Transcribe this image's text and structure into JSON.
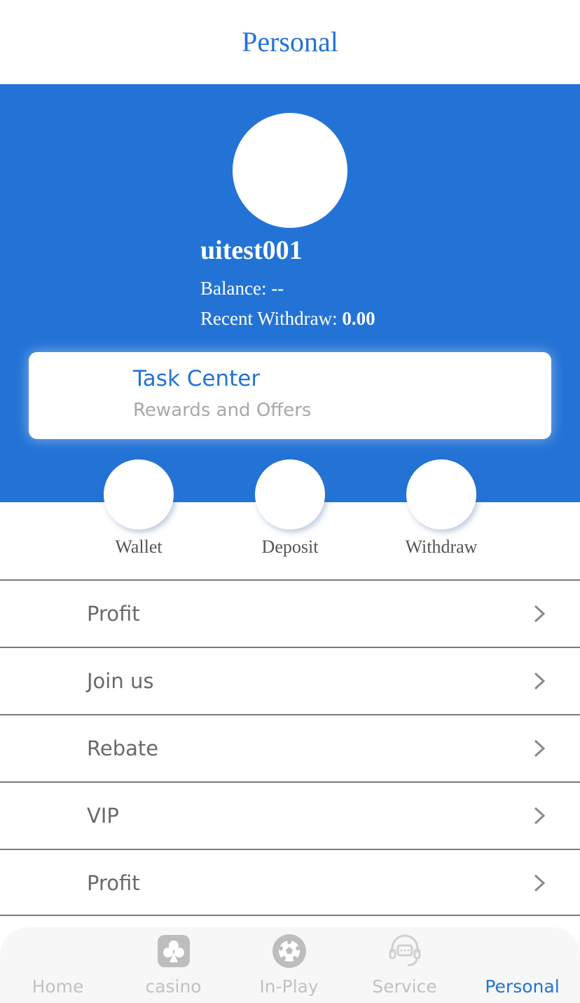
{
  "header": {
    "title": "Personal"
  },
  "profile": {
    "username": "uitest001",
    "balance_label": "Balance: --",
    "recent_withdraw_label": "Recent Withdraw: ",
    "recent_withdraw_value": "0.00"
  },
  "task_center": {
    "title": "Task Center",
    "subtitle": "Rewards and Offers"
  },
  "actions": [
    {
      "label": "Wallet"
    },
    {
      "label": "Deposit"
    },
    {
      "label": "Withdraw"
    }
  ],
  "menu": [
    {
      "label": "Profit",
      "icon": "chevron-right-icon"
    },
    {
      "label": "Join us",
      "icon": "chevron-right-icon"
    },
    {
      "label": "Rebate",
      "icon": "chevron-right-icon"
    },
    {
      "label": "VIP",
      "icon": "chevron-right-icon"
    },
    {
      "label": "Profit",
      "icon": "chevron-right-icon"
    }
  ],
  "tabs": [
    {
      "label": "Home",
      "icon": "home-icon",
      "active": false
    },
    {
      "label": "casino",
      "icon": "casino-club-icon",
      "active": false
    },
    {
      "label": "In-Play",
      "icon": "soccer-ball-icon",
      "active": false
    },
    {
      "label": "Service",
      "icon": "headset-chat-icon",
      "active": false
    },
    {
      "label": "Personal",
      "icon": "personal-icon",
      "active": true
    }
  ],
  "colors": {
    "accent": "#2373d6",
    "inactive": "#c2c2c2",
    "menu_text": "#6a6a6a",
    "subtitle": "#a8a8a8"
  }
}
